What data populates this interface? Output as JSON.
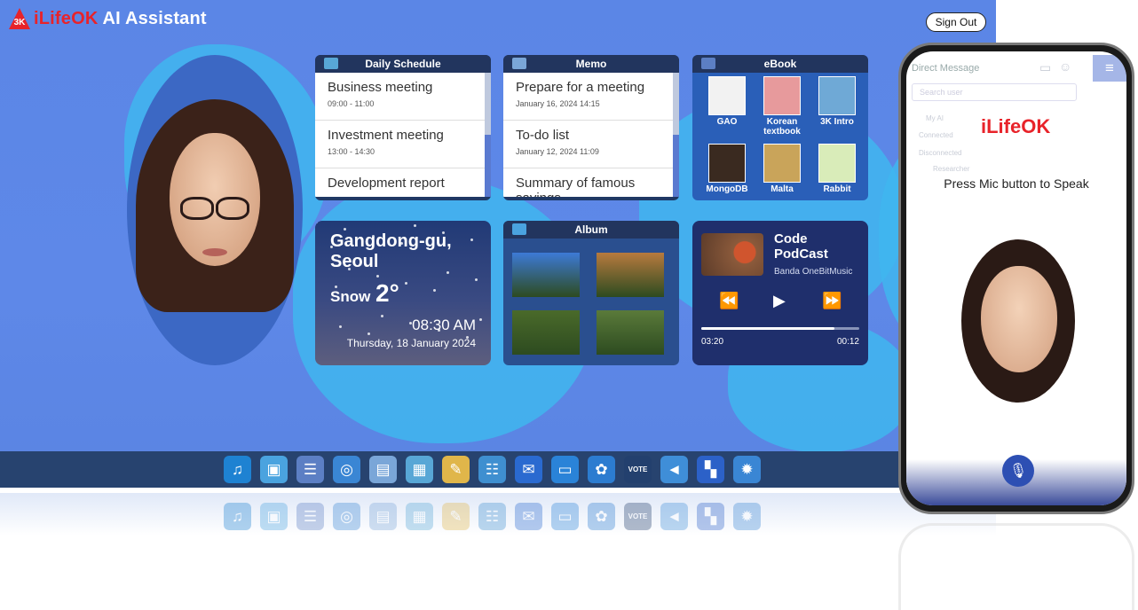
{
  "app": {
    "logo_mark": "3K",
    "logo_brand": "iLifeOK",
    "logo_suffix": " AI Assistant",
    "sign_out": "Sign Out"
  },
  "schedule": {
    "title": "Daily Schedule",
    "items": [
      {
        "title": "Business meeting",
        "sub": "09:00 - 11:00"
      },
      {
        "title": "Investment meeting",
        "sub": "13:00 - 14:30"
      },
      {
        "title": "Development report",
        "sub": ""
      }
    ]
  },
  "memo": {
    "title": "Memo",
    "items": [
      {
        "title": "Prepare for a meeting",
        "sub": "January 16, 2024 14:15"
      },
      {
        "title": "To-do list",
        "sub": "January 12, 2024 11:09"
      },
      {
        "title": "Summary of famous sayings",
        "sub": ""
      }
    ]
  },
  "ebook": {
    "title": "eBook",
    "books": [
      {
        "label": "GAO",
        "color": "#f2f2f2"
      },
      {
        "label": "Korean textbook",
        "color": "#e79a9c"
      },
      {
        "label": "3K Intro",
        "color": "#6fa9d6"
      },
      {
        "label": "MongoDB",
        "color": "#3a2a20"
      },
      {
        "label": "Malta",
        "color": "#c9a45a"
      },
      {
        "label": "Rabbit",
        "color": "#d9ecb9"
      }
    ]
  },
  "weather": {
    "city": "Gangdong-gu, Seoul",
    "condition": "Snow",
    "temp": "2°",
    "time": "08:30 AM",
    "date": "Thursday, 18 January 2024"
  },
  "album": {
    "title": "Album",
    "photos": [
      {
        "name": "photo-sky",
        "color": "#3d7ad6"
      },
      {
        "name": "photo-dog",
        "color": "#b77a3e"
      },
      {
        "name": "photo-vine",
        "color": "#4a6a2a"
      },
      {
        "name": "photo-vineyard",
        "color": "#5a7a3a"
      }
    ]
  },
  "music": {
    "title": "Code PodCast",
    "artist": "Banda OneBitMusic",
    "current": "03:20",
    "end": "00:12",
    "progress": 0.84,
    "prev": "⏪",
    "play": "▶",
    "next": "⏩"
  },
  "dock": {
    "icons": [
      {
        "name": "music-icon",
        "glyph": "♫",
        "bg": "#1e82d2"
      },
      {
        "name": "gallery-icon",
        "glyph": "▣",
        "bg": "#4aa3df"
      },
      {
        "name": "ebook-icon",
        "glyph": "☰",
        "bg": "#5c7fc4"
      },
      {
        "name": "globe-icon",
        "glyph": "◎",
        "bg": "#3a86d4"
      },
      {
        "name": "memo-icon",
        "glyph": "▤",
        "bg": "#7aa6d8"
      },
      {
        "name": "calendar-icon",
        "glyph": "▦",
        "bg": "#58a7d6"
      },
      {
        "name": "notes-icon",
        "glyph": "✎",
        "bg": "#e0b64a"
      },
      {
        "name": "contacts-icon",
        "glyph": "☷",
        "bg": "#3f8fd0"
      },
      {
        "name": "mail-icon",
        "glyph": "✉",
        "bg": "#2a6ad0"
      },
      {
        "name": "chat-icon",
        "glyph": "▭",
        "bg": "#2a83d8"
      },
      {
        "name": "openai-icon",
        "glyph": "✿",
        "bg": "#2c7cd0"
      },
      {
        "name": "vote-icon",
        "glyph": "✔",
        "bg": "#23406e"
      },
      {
        "name": "megaphone-icon",
        "glyph": "◄",
        "bg": "#3f8ed8"
      },
      {
        "name": "apps-icon",
        "glyph": "▚",
        "bg": "#2c61c8"
      },
      {
        "name": "settings-icon",
        "glyph": "✹",
        "bg": "#3a86d4"
      }
    ],
    "vote_label": "VOTE"
  },
  "phone": {
    "header": "Direct Message",
    "search_placeholder": "Search user",
    "my_ai": "My AI",
    "connected": "Connected",
    "disconnected": "Disconnected",
    "researcher": "Researcher",
    "brand": "iLifeOK",
    "prompt": "Press Mic button to Speak",
    "menu_glyph": "≡",
    "mic_glyph": "🎙"
  }
}
